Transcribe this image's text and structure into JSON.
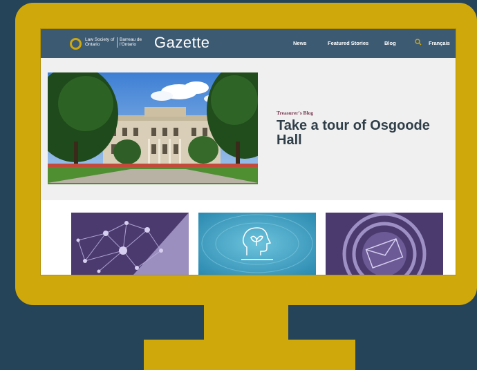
{
  "header": {
    "logo_en": "Law Society of Ontario",
    "logo_fr": "Barreau de l'Ontario",
    "brand": "Gazette"
  },
  "nav": {
    "items": [
      {
        "label": "News"
      },
      {
        "label": "Featured Stories"
      },
      {
        "label": "Blog"
      }
    ],
    "language": "Français"
  },
  "hero": {
    "kicker": "Treasurer's Blog",
    "title": "Take a tour of Osgoode Hall",
    "slide_count": 4,
    "active_slide": 1
  },
  "cards": [
    {
      "icon": "network-graph-icon",
      "bg": "#4b3a6e"
    },
    {
      "icon": "head-leaf-icon",
      "bg": "#3aa0c4"
    },
    {
      "icon": "envelope-icon",
      "bg": "#4b3a6e"
    }
  ],
  "colors": {
    "background": "#264459",
    "monitor": "#cfa80c",
    "navbar": "#3d5a73",
    "accent": "#a0195a"
  }
}
